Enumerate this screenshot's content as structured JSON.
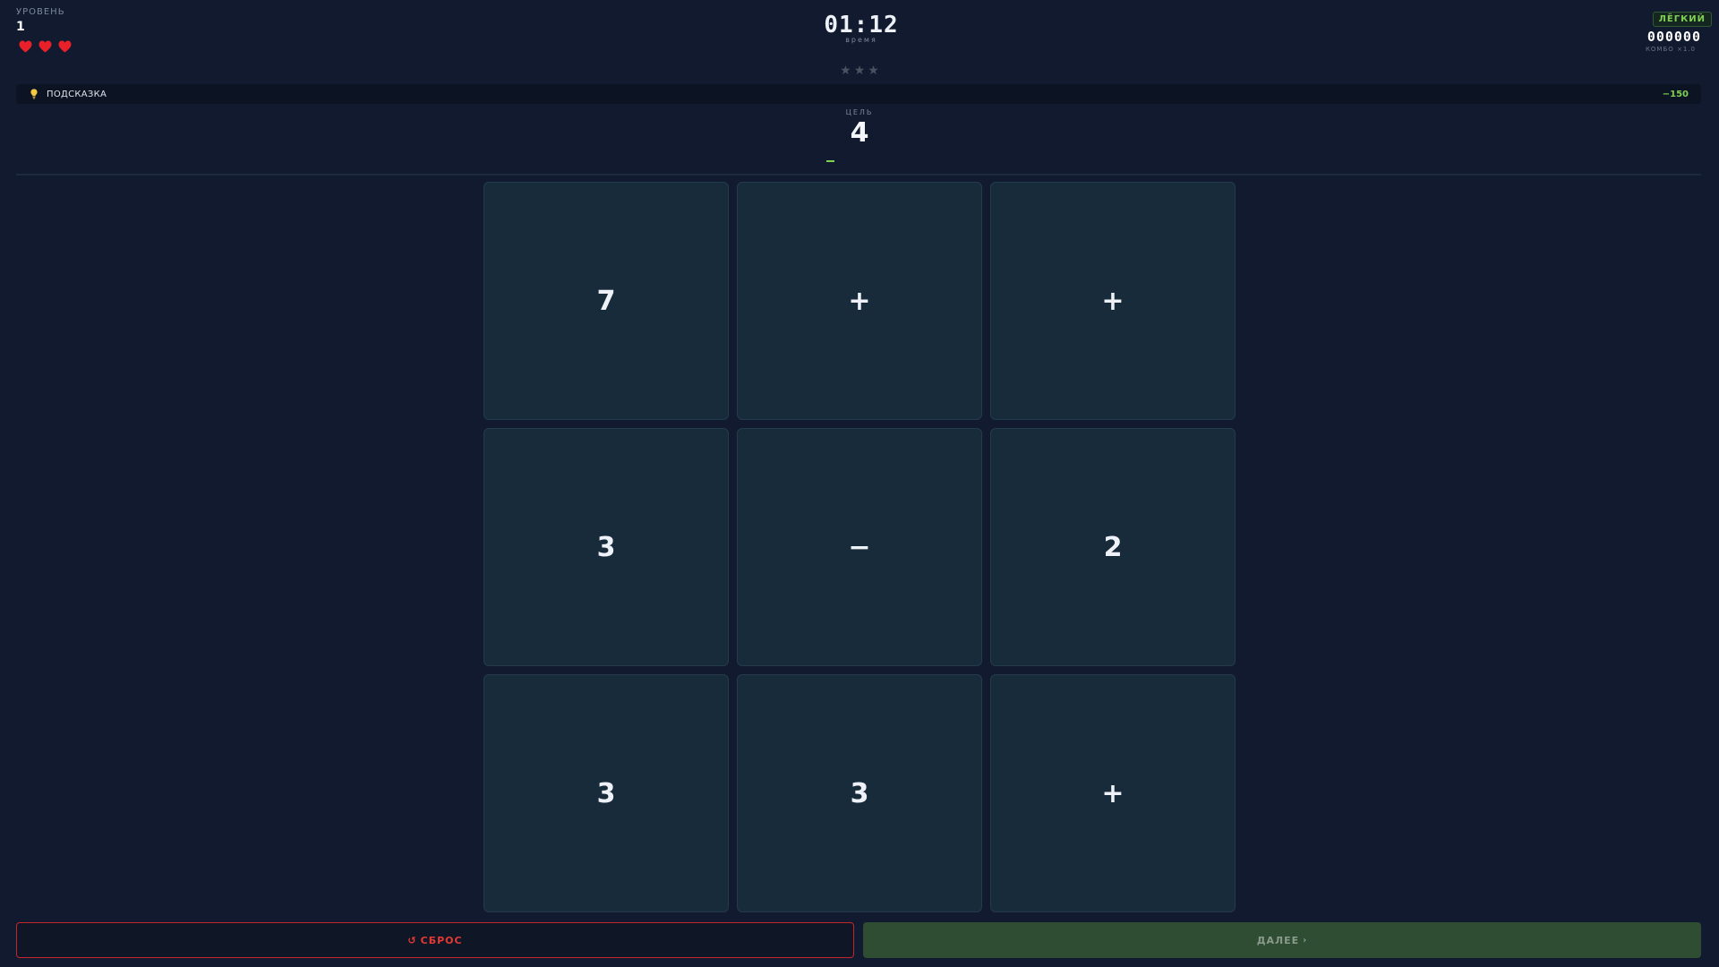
{
  "hud": {
    "level_label": "УРОВЕНЬ",
    "level_value": "1",
    "lives": 3,
    "timer": "01:12",
    "timer_label": "время",
    "difficulty": "ЛЁГКИЙ",
    "score": "000000",
    "combo": "КОМБО ×1.0"
  },
  "stars": {
    "total": 3,
    "earned": 0,
    "glyph": "★"
  },
  "hint": {
    "icon": "lightbulb-icon",
    "label": "ПОДСКАЗКА",
    "cost": "−150"
  },
  "target": {
    "label": "ЦЕЛЬ",
    "value": "4"
  },
  "board": {
    "tiles": [
      "7",
      "+",
      "+",
      "3",
      "−",
      "2",
      "3",
      "3",
      "+"
    ]
  },
  "buttons": {
    "reset_icon": "↺",
    "reset_label": "СБРОС",
    "next_label": "ДАЛЕЕ",
    "next_icon": "›"
  },
  "colors": {
    "background": "#111a2e",
    "tile": "#182b3b",
    "accent_green": "#7fd153",
    "danger_red": "#e53935",
    "heart_red": "#e8202a",
    "next_button": "#2f4d33"
  }
}
